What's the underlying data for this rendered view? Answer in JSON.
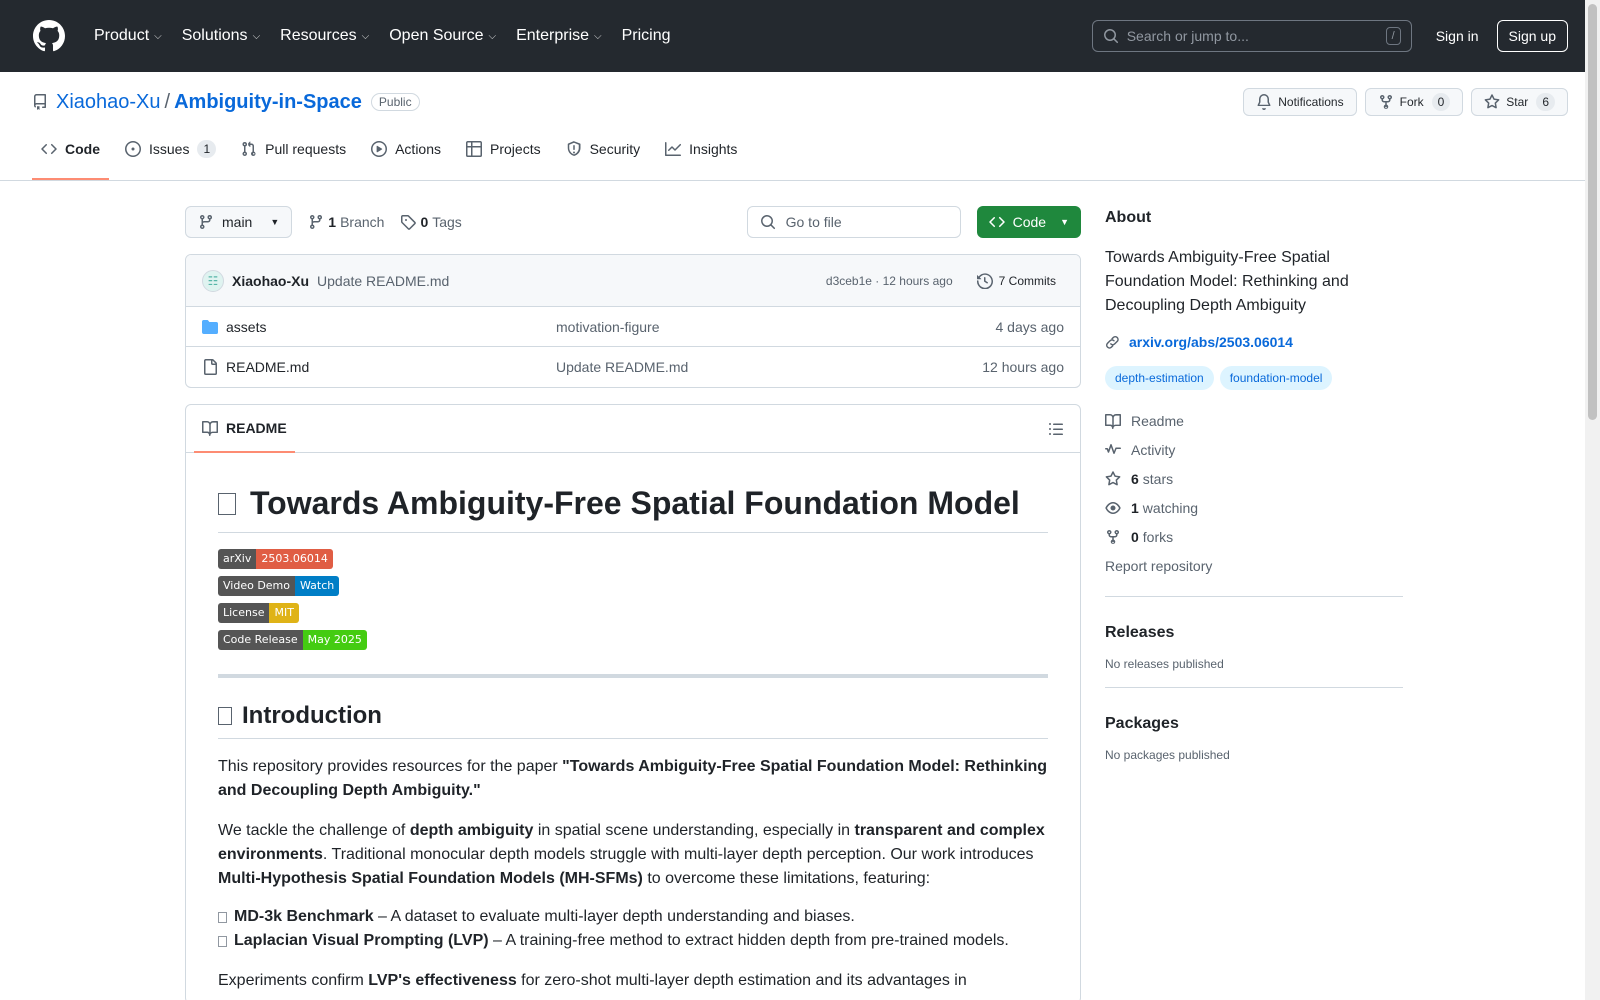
{
  "header": {
    "nav": [
      "Product",
      "Solutions",
      "Resources",
      "Open Source",
      "Enterprise"
    ],
    "pricing": "Pricing",
    "search_placeholder": "Search or jump to...",
    "search_shortcut": "/",
    "signin": "Sign in",
    "signup": "Sign up"
  },
  "repo": {
    "owner": "Xiaohao-Xu",
    "separator": "/",
    "name": "Ambiguity-in-Space",
    "visibility": "Public",
    "notifications_label": "Notifications",
    "fork_label": "Fork",
    "fork_count": "0",
    "star_label": "Star",
    "star_count": "6"
  },
  "tabs": [
    {
      "label": "Code",
      "icon": "code-icon"
    },
    {
      "label": "Issues",
      "icon": "issue-icon",
      "count": "1"
    },
    {
      "label": "Pull requests",
      "icon": "pull-request-icon"
    },
    {
      "label": "Actions",
      "icon": "play-icon"
    },
    {
      "label": "Projects",
      "icon": "table-icon"
    },
    {
      "label": "Security",
      "icon": "shield-icon"
    },
    {
      "label": "Insights",
      "icon": "graph-icon"
    }
  ],
  "toolbar": {
    "branch": "main",
    "branch_count": "1",
    "branch_label": "Branch",
    "tag_count": "0",
    "tag_label": "Tags",
    "gofile_placeholder": "Go to file",
    "code_button": "Code"
  },
  "commit": {
    "author": "Xiaohao-Xu",
    "message": "Update README.md",
    "meta": "d3ceb1e · 12 hours ago",
    "commits_label": "7 Commits"
  },
  "files": [
    {
      "name": "assets",
      "type": "folder",
      "message": "motivation-figure",
      "time": "4 days ago"
    },
    {
      "name": "README.md",
      "type": "file",
      "message": "Update README.md",
      "time": "12 hours ago"
    }
  ],
  "readme": {
    "tab_label": "README",
    "h1": "Towards Ambiguity-Free Spatial Foundation Model",
    "badges": [
      {
        "left": "arXiv",
        "right": "2503.06014",
        "color": "#e05d44"
      },
      {
        "left": "Video Demo",
        "right": "Watch",
        "color": "#007ec6"
      },
      {
        "left": "License",
        "right": "MIT",
        "color": "#dfb317"
      },
      {
        "left": "Code Release",
        "right": "May 2025",
        "color": "#4c1"
      }
    ],
    "h2": "Introduction",
    "p1_a": "This repository provides resources for the paper ",
    "p1_b": "\"Towards Ambiguity-Free Spatial Foundation Model: Rethinking and Decoupling Depth Ambiguity.\"",
    "p2_a": "We tackle the challenge of ",
    "p2_b": "depth ambiguity",
    "p2_c": " in spatial scene understanding, especially in ",
    "p2_d": "transparent and complex environments",
    "p2_e": ". Traditional monocular depth models struggle with multi-layer depth perception. Our work introduces ",
    "p2_f": "Multi-Hypothesis Spatial Foundation Models (MH-SFMs)",
    "p2_g": " to overcome these limitations, featuring:",
    "li1_b": "MD-3k Benchmark",
    "li1_t": " – A dataset to evaluate multi-layer depth understanding and biases.",
    "li2_b": "Laplacian Visual Prompting (LVP)",
    "li2_t": " – A training-free method to extract hidden depth from pre-trained models.",
    "p3_a": "Experiments confirm ",
    "p3_b": "LVP's effectiveness",
    "p3_c": " for zero-shot multi-layer depth estimation and its advantages in"
  },
  "about": {
    "title": "About",
    "description": "Towards Ambiguity-Free Spatial Foundation Model: Rethinking and Decoupling Depth Ambiguity",
    "link": "arxiv.org/abs/2503.06014",
    "topics": [
      "depth-estimation",
      "foundation-model"
    ],
    "readme": "Readme",
    "activity": "Activity",
    "stars_count": "6",
    "stars_label": "stars",
    "watching_count": "1",
    "watching_label": "watching",
    "forks_count": "0",
    "forks_label": "forks",
    "report": "Report repository"
  },
  "releases": {
    "title": "Releases",
    "text": "No releases published"
  },
  "packages": {
    "title": "Packages",
    "text": "No packages published"
  }
}
